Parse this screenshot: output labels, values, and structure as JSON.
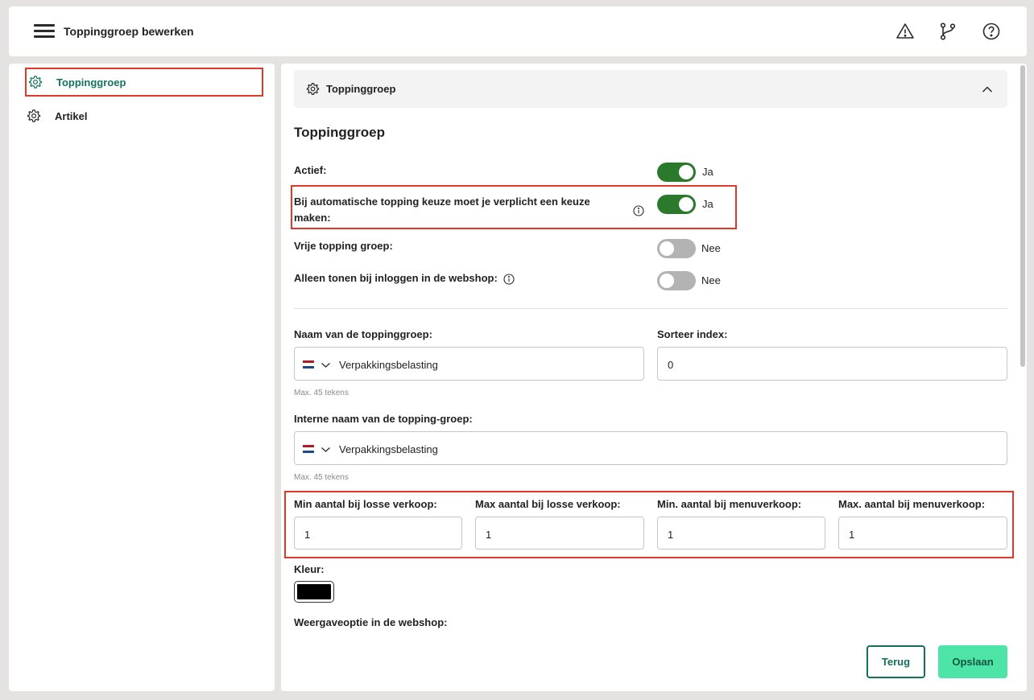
{
  "header": {
    "title": "Toppinggroep bewerken",
    "icons": [
      "menu-icon",
      "warning-icon",
      "branch-icon",
      "help-icon"
    ]
  },
  "sidebar": {
    "items": [
      {
        "label": "Toppinggroep",
        "icon": "gear-icon",
        "active": true
      },
      {
        "label": "Artikel",
        "icon": "gear-icon",
        "active": false
      }
    ]
  },
  "accordion": {
    "title": "Toppinggroep",
    "expanded": true
  },
  "section": {
    "title": "Toppinggroep"
  },
  "toggles": [
    {
      "label": "Actief:",
      "on": true,
      "value": "Ja"
    },
    {
      "label": "Bij automatische topping keuze moet je verplicht een keuze maken:",
      "on": true,
      "value": "Ja",
      "has_info": true
    },
    {
      "label": "Vrije topping groep:",
      "on": false,
      "value": "Nee"
    },
    {
      "label": "Alleen tonen bij inloggen in de webshop:",
      "on": false,
      "value": "Nee",
      "has_info": true
    }
  ],
  "fields": {
    "name": {
      "label": "Naam van de toppinggroep:",
      "value": "Verpakkingsbelasting",
      "hint": "Max. 45 tekens"
    },
    "sort_index": {
      "label": "Sorteer index:",
      "value": "0"
    },
    "internal_name": {
      "label": "Interne naam van de topping-groep:",
      "value": "Verpakkingsbelasting",
      "hint": "Max. 45 tekens"
    },
    "min_loose": {
      "label": "Min aantal bij losse verkoop:",
      "value": "1"
    },
    "max_loose": {
      "label": "Max aantal bij losse verkoop:",
      "value": "1"
    },
    "min_menu": {
      "label": "Min. aantal bij menuverkoop:",
      "value": "1"
    },
    "max_menu": {
      "label": "Max. aantal bij menuverkoop:",
      "value": "1"
    },
    "color": {
      "label": "Kleur:",
      "value": "#000000"
    },
    "display_option": {
      "label": "Weergaveoptie in de webshop:"
    }
  },
  "buttons": {
    "back": "Terug",
    "save": "Opslaan"
  },
  "colors": {
    "accent": "#14745e",
    "toggle_on": "#2b7a2c",
    "toggle_off": "#b3b3b3",
    "save_bg": "#4ce4a7",
    "highlight": "#e0382b"
  }
}
